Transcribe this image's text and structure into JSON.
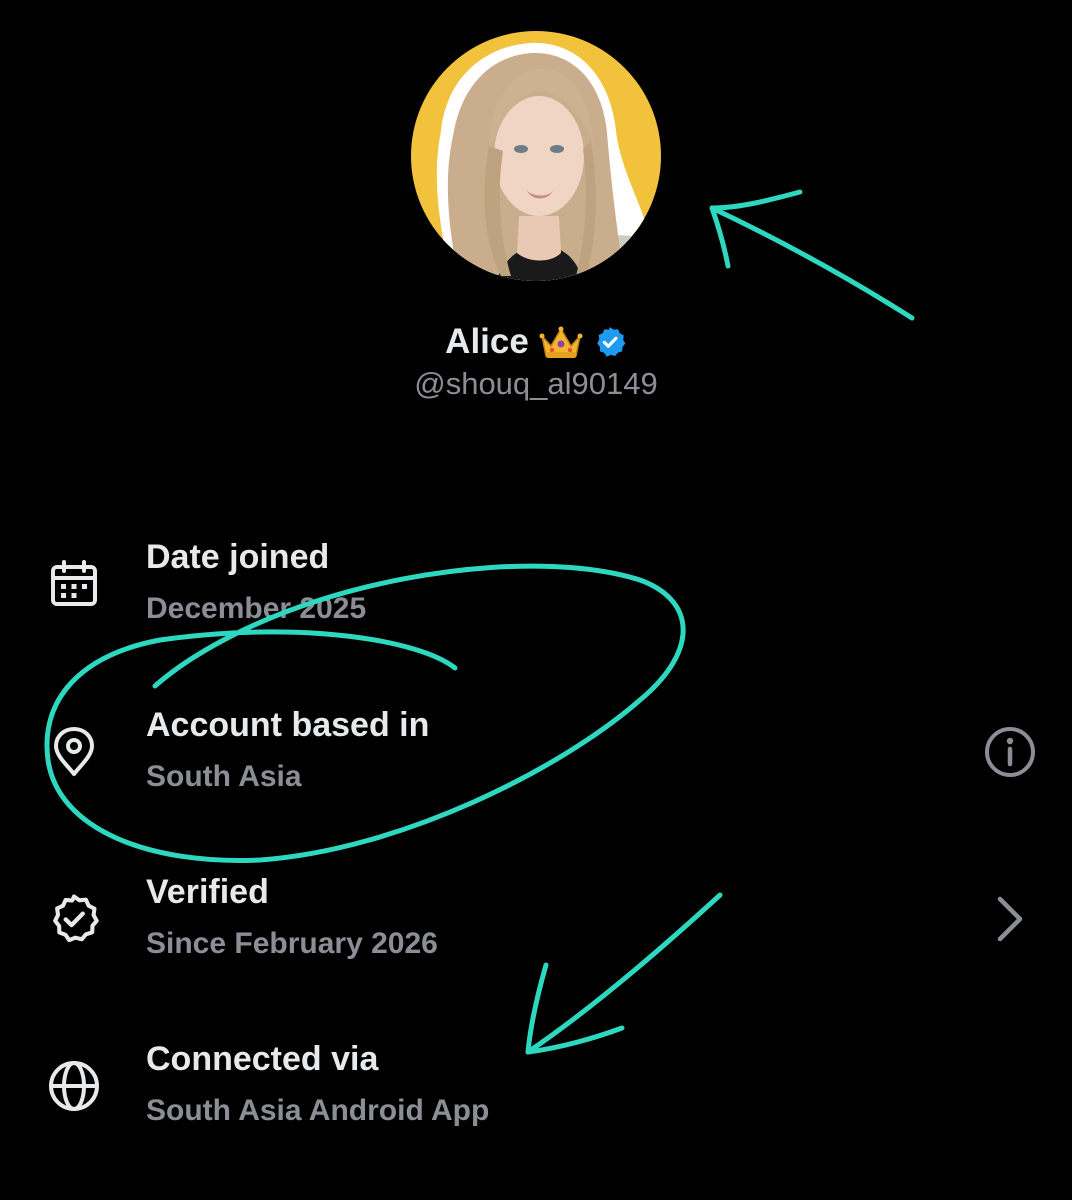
{
  "profile": {
    "name": "Alice",
    "name_emoji": "crown",
    "verified_badge": "verified-check-icon",
    "handle": "@shouq_al90149",
    "avatar_background": "#f2c23c"
  },
  "rows": [
    {
      "icon": "calendar-icon",
      "title": "Date joined",
      "value": "December 2025",
      "trailing": ""
    },
    {
      "icon": "location-pin-icon",
      "title": "Account based in",
      "value": "South Asia",
      "trailing": "info-icon"
    },
    {
      "icon": "verified-badge-icon",
      "title": "Verified",
      "value": "Since February 2026",
      "trailing": "chevron-right-icon"
    },
    {
      "icon": "globe-icon",
      "title": "Connected via",
      "value": "South Asia Android App",
      "trailing": ""
    }
  ],
  "colors": {
    "background": "#000000",
    "primary_text": "#e7e9ea",
    "secondary_text": "#8b8f95",
    "verified_blue": "#1d9bf0",
    "annotation": "#2ed8c0"
  }
}
